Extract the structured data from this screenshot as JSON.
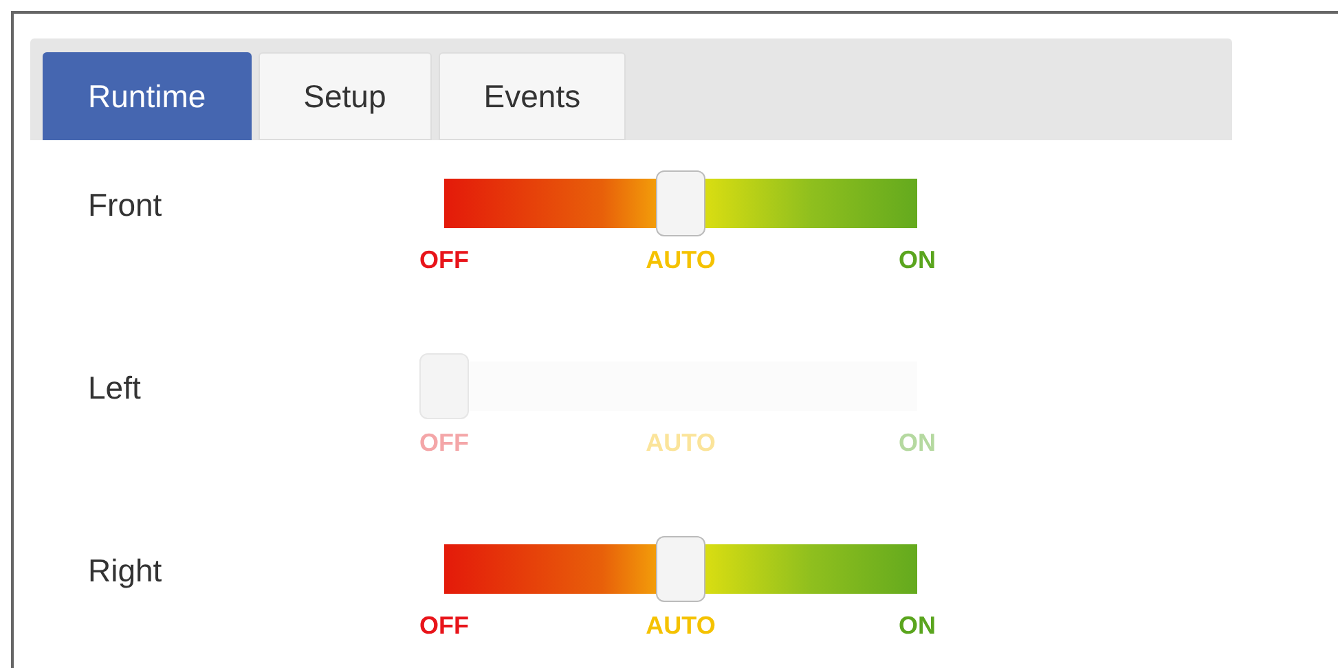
{
  "tabs": [
    {
      "label": "Runtime",
      "selected": true
    },
    {
      "label": "Setup",
      "selected": false
    },
    {
      "label": "Events",
      "selected": false
    }
  ],
  "sliders": [
    {
      "name": "Front",
      "disabled": false,
      "level": 0.5,
      "scale": [
        {
          "label": "OFF",
          "color": "#e8141a"
        },
        {
          "label": "AUTO",
          "color": "#f5c200"
        },
        {
          "label": "ON",
          "color": "#5aa51e"
        }
      ]
    },
    {
      "name": "Left",
      "disabled": true,
      "level": 0,
      "scale": [
        {
          "label": "OFF",
          "color": "#f4a6a8"
        },
        {
          "label": "AUTO",
          "color": "#fbe49a"
        },
        {
          "label": "ON",
          "color": "#b5d9a0"
        }
      ]
    },
    {
      "name": "Right",
      "disabled": false,
      "level": 0.5,
      "scale": [
        {
          "label": "OFF",
          "color": "#e8141a"
        },
        {
          "label": "AUTO",
          "color": "#f5c200"
        },
        {
          "label": "ON",
          "color": "#5aa51e"
        }
      ]
    }
  ]
}
